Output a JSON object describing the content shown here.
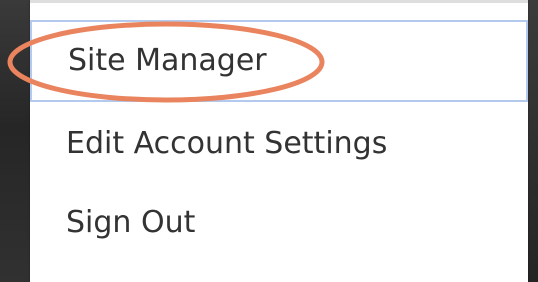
{
  "menu": {
    "items": [
      {
        "label": "Site Manager"
      },
      {
        "label": "Edit Account Settings"
      },
      {
        "label": "Sign Out"
      }
    ]
  },
  "annotation": {
    "shape": "ellipse",
    "color": "#e9845f",
    "target": "Site Manager"
  },
  "colors": {
    "menu_background": "#ffffff",
    "menu_text": "#333333",
    "selected_item_border": "#b3c9ee",
    "backdrop": "#2b2b2b"
  }
}
